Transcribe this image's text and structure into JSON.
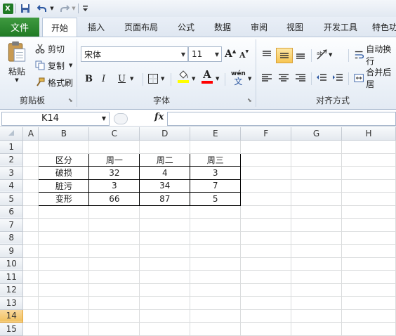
{
  "app": {
    "icon_letter": "X"
  },
  "qat": {
    "more": "▼"
  },
  "tabs": [
    {
      "label": "文件"
    },
    {
      "label": "开始"
    },
    {
      "label": "插入"
    },
    {
      "label": "页面布局"
    },
    {
      "label": "公式"
    },
    {
      "label": "数据"
    },
    {
      "label": "审阅"
    },
    {
      "label": "视图"
    },
    {
      "label": "开发工具"
    },
    {
      "label": "特色功"
    }
  ],
  "ribbon": {
    "clipboard": {
      "paste": "粘贴",
      "cut": "剪切",
      "copy": "复制",
      "format_painter": "格式刷",
      "title": "剪贴板"
    },
    "font": {
      "name": "宋体",
      "size": "11",
      "bold": "B",
      "italic": "I",
      "underline": "U",
      "grow": "A",
      "shrink": "A",
      "font_color_letter": "A",
      "phonetic": "wén",
      "phonetic_char": "文",
      "title": "字体"
    },
    "alignment": {
      "wrap_text": "自动换行",
      "merge_center": "合并后居",
      "title": "对齐方式"
    }
  },
  "formula_bar": {
    "cell_ref": "K14",
    "fx": "fx",
    "value": ""
  },
  "sheet": {
    "columns": [
      "A",
      "B",
      "C",
      "D",
      "E",
      "F",
      "G",
      "H"
    ],
    "rows": [
      "1",
      "2",
      "3",
      "4",
      "5",
      "6",
      "7",
      "8",
      "9",
      "10",
      "11",
      "12",
      "13",
      "14",
      "15"
    ],
    "selected_row": "14",
    "table": [
      [
        "区分",
        "周一",
        "周二",
        "周三"
      ],
      [
        "破损",
        "32",
        "4",
        "3"
      ],
      [
        "脏污",
        "3",
        "34",
        "7"
      ],
      [
        "变形",
        "66",
        "87",
        "5"
      ]
    ]
  },
  "colors": {
    "file_tab": "#1f7a25",
    "highlight": "#ffff00",
    "font_color": "#ff0000",
    "selected_header": "#f1c15f"
  }
}
